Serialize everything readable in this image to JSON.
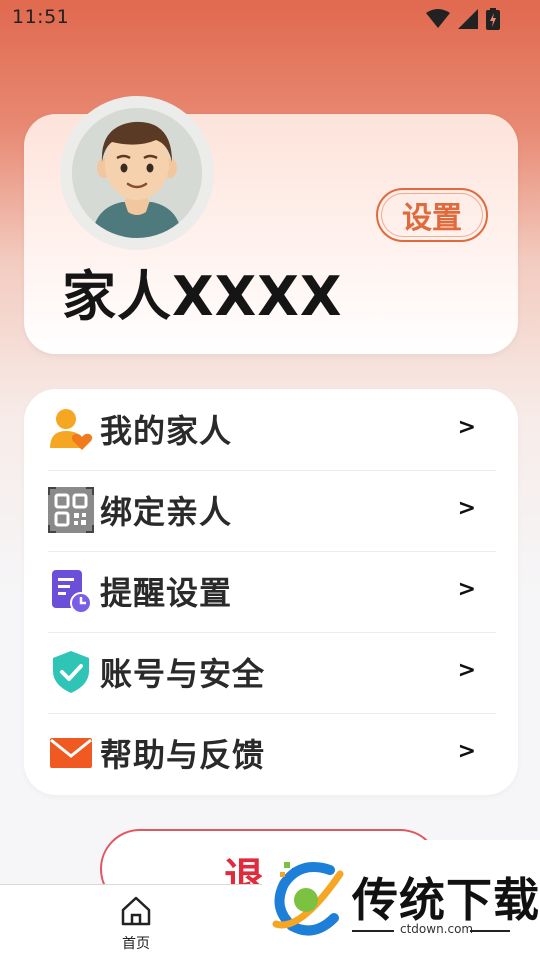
{
  "status_bar": {
    "time": "11:51"
  },
  "profile": {
    "name": "家人XXXX",
    "settings_label": "设置"
  },
  "menu": {
    "items": [
      {
        "label": "我的家人",
        "icon": "family-heart-icon",
        "chevron": ">"
      },
      {
        "label": "绑定亲人",
        "icon": "qr-code-scan-icon",
        "chevron": ">"
      },
      {
        "label": "提醒设置",
        "icon": "reminder-document-icon",
        "chevron": ">"
      },
      {
        "label": "账号与安全",
        "icon": "shield-check-icon",
        "chevron": ">"
      },
      {
        "label": "帮助与反馈",
        "icon": "mail-envelope-icon",
        "chevron": ">"
      }
    ]
  },
  "logout": {
    "label": "退出"
  },
  "bottom_nav": {
    "items": [
      {
        "label": "首页",
        "icon": "home-icon"
      }
    ]
  },
  "watermark": {
    "title": "传统下载",
    "url": "ctdown.com"
  },
  "colors": {
    "accent_orange": "#e06a3c",
    "logout_red": "#e02b3c",
    "header_gradient_top": "#e0694e"
  }
}
